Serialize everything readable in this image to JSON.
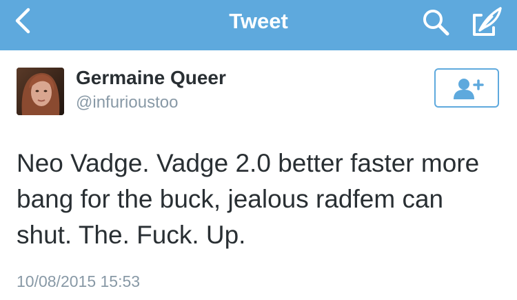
{
  "nav": {
    "title": "Tweet",
    "back_icon": "chevron-left-icon",
    "search_icon": "search-icon",
    "compose_icon": "compose-tweet-icon",
    "background_color": "#5ea9dd"
  },
  "tweet": {
    "author_name": "Germaine Queer",
    "author_handle": "@infurioustoo",
    "text": "Neo Vadge. Vadge 2.0 better faster more bang for the buck, jealous radfem can shut. The. Fuck. Up.",
    "timestamp": "10/08/2015 15:53"
  },
  "follow_button": {
    "icon": "add-user-icon",
    "color": "#5ea9dd"
  },
  "colors": {
    "name": "#292f33",
    "secondary_text": "#8899a6",
    "accent": "#5ea9dd"
  }
}
